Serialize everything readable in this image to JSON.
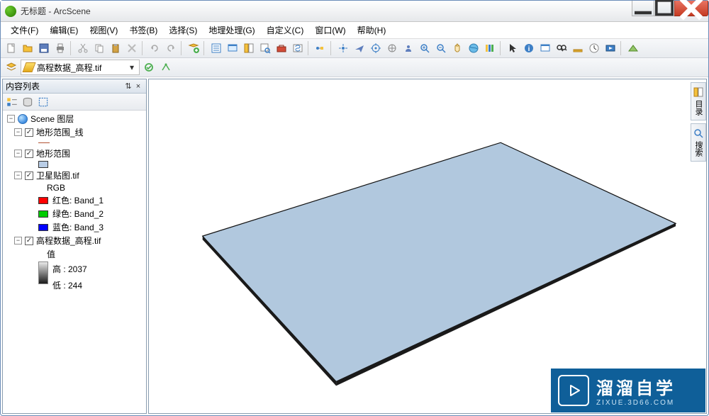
{
  "window": {
    "title": "无标题 - ArcScene"
  },
  "menu": {
    "file": "文件(F)",
    "edit": "编辑(E)",
    "view": "视图(V)",
    "bookmark": "书签(B)",
    "select": "选择(S)",
    "geoproc": "地理处理(G)",
    "custom": "自定义(C)",
    "window": "窗口(W)",
    "help": "帮助(H)"
  },
  "toolbar2": {
    "layer": "高程数据_高程.tif"
  },
  "toc": {
    "title": "内容列表",
    "root": "Scene 图层",
    "layer_line": "地形范围_线",
    "layer_poly": "地形范围",
    "layer_sat": "卫星贴图.tif",
    "sat_rgb": "RGB",
    "sat_r": "红色:   Band_1",
    "sat_g": "绿色:  Band_2",
    "sat_b": "蓝色:   Band_3",
    "layer_dem": "高程数据_高程.tif",
    "dem_value": "值",
    "dem_high": "高 : 2037",
    "dem_low": "低 : 244"
  },
  "dock": {
    "catalog": "目录",
    "search": "搜索"
  },
  "badge": {
    "title": "溜溜自学",
    "url": "ZIXUE.3D66.COM"
  }
}
